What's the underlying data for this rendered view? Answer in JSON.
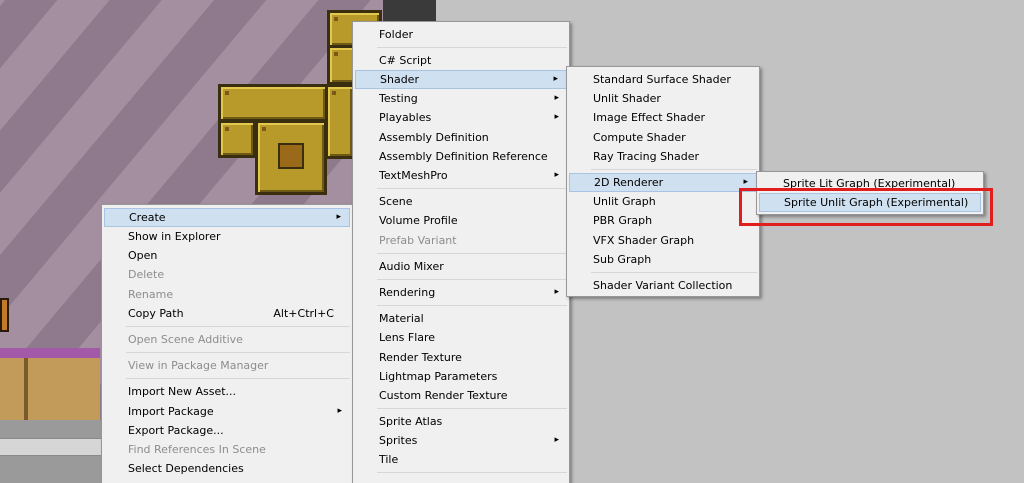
{
  "context_menu": {
    "items": [
      {
        "label": "Create",
        "submenu": true,
        "highlighted": true
      },
      {
        "label": "Show in Explorer"
      },
      {
        "label": "Open"
      },
      {
        "label": "Delete",
        "disabled": true
      },
      {
        "label": "Rename",
        "disabled": true
      },
      {
        "label": "Copy Path",
        "shortcut": "Alt+Ctrl+C"
      },
      {
        "label": "Open Scene Additive",
        "disabled": true
      },
      {
        "label": "View in Package Manager",
        "disabled": true
      },
      {
        "label": "Import New Asset..."
      },
      {
        "label": "Import Package",
        "submenu": true
      },
      {
        "label": "Export Package..."
      },
      {
        "label": "Find References In Scene",
        "disabled": true
      },
      {
        "label": "Select Dependencies"
      }
    ]
  },
  "create_menu": {
    "items": [
      {
        "label": "Folder"
      },
      {
        "label": "C# Script"
      },
      {
        "label": "Shader",
        "submenu": true,
        "highlighted": true
      },
      {
        "label": "Testing",
        "submenu": true
      },
      {
        "label": "Playables",
        "submenu": true
      },
      {
        "label": "Assembly Definition"
      },
      {
        "label": "Assembly Definition Reference"
      },
      {
        "label": "TextMeshPro",
        "submenu": true
      },
      {
        "label": "Scene"
      },
      {
        "label": "Volume Profile"
      },
      {
        "label": "Prefab Variant",
        "disabled": true
      },
      {
        "label": "Audio Mixer"
      },
      {
        "label": "Rendering",
        "submenu": true
      },
      {
        "label": "Material"
      },
      {
        "label": "Lens Flare"
      },
      {
        "label": "Render Texture"
      },
      {
        "label": "Lightmap Parameters"
      },
      {
        "label": "Custom Render Texture"
      },
      {
        "label": "Sprite Atlas"
      },
      {
        "label": "Sprites",
        "submenu": true
      },
      {
        "label": "Tile"
      }
    ]
  },
  "shader_menu": {
    "items": [
      {
        "label": "Standard Surface Shader"
      },
      {
        "label": "Unlit Shader"
      },
      {
        "label": "Image Effect Shader"
      },
      {
        "label": "Compute Shader"
      },
      {
        "label": "Ray Tracing Shader"
      },
      {
        "label": "2D Renderer",
        "submenu": true,
        "highlighted": true
      },
      {
        "label": "Unlit Graph"
      },
      {
        "label": "PBR Graph"
      },
      {
        "label": "VFX Shader Graph"
      },
      {
        "label": "Sub Graph"
      },
      {
        "label": "Shader Variant Collection"
      }
    ]
  },
  "renderer2d_menu": {
    "items": [
      {
        "label": "Sprite Lit Graph (Experimental)"
      },
      {
        "label": "Sprite Unlit Graph (Experimental)",
        "highlighted": true
      }
    ]
  },
  "icons": {
    "submenu_arrow": "▸"
  },
  "colors": {
    "highlight_box": "#e01e1e",
    "menu_bg": "#f0f0f0",
    "hover_bg": "#cfe0f0"
  }
}
